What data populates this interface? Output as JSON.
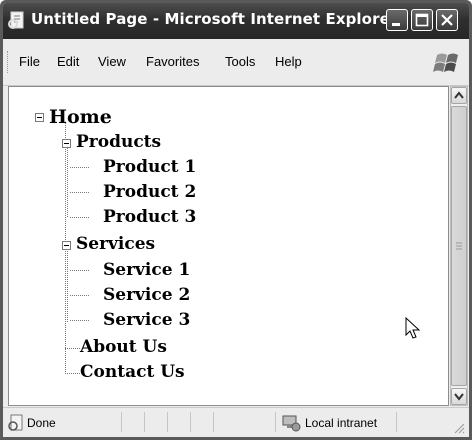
{
  "window": {
    "title": "Untitled Page - Microsoft Internet Explorer"
  },
  "menu": {
    "items": [
      "File",
      "Edit",
      "View",
      "Favorites",
      "Tools",
      "Help"
    ]
  },
  "tree": {
    "root": {
      "label": "Home",
      "expanded": true,
      "children": [
        {
          "label": "Products",
          "expanded": true,
          "children": [
            {
              "label": "Product 1"
            },
            {
              "label": "Product 2"
            },
            {
              "label": "Product 3"
            }
          ]
        },
        {
          "label": "Services",
          "expanded": true,
          "children": [
            {
              "label": "Service 1"
            },
            {
              "label": "Service 2"
            },
            {
              "label": "Service 3"
            }
          ]
        },
        {
          "label": "About Us"
        },
        {
          "label": "Contact Us"
        }
      ]
    }
  },
  "status": {
    "text": "Done",
    "zone": "Local intranet"
  },
  "icons": {
    "title": "ie-page-icon",
    "window_buttons": [
      "minimize-icon",
      "maximize-icon",
      "close-icon"
    ],
    "brand": "windows-flag-icon",
    "status": "page-done-icon",
    "zone": "intranet-icon",
    "cursor": "mouse-pointer-icon"
  }
}
